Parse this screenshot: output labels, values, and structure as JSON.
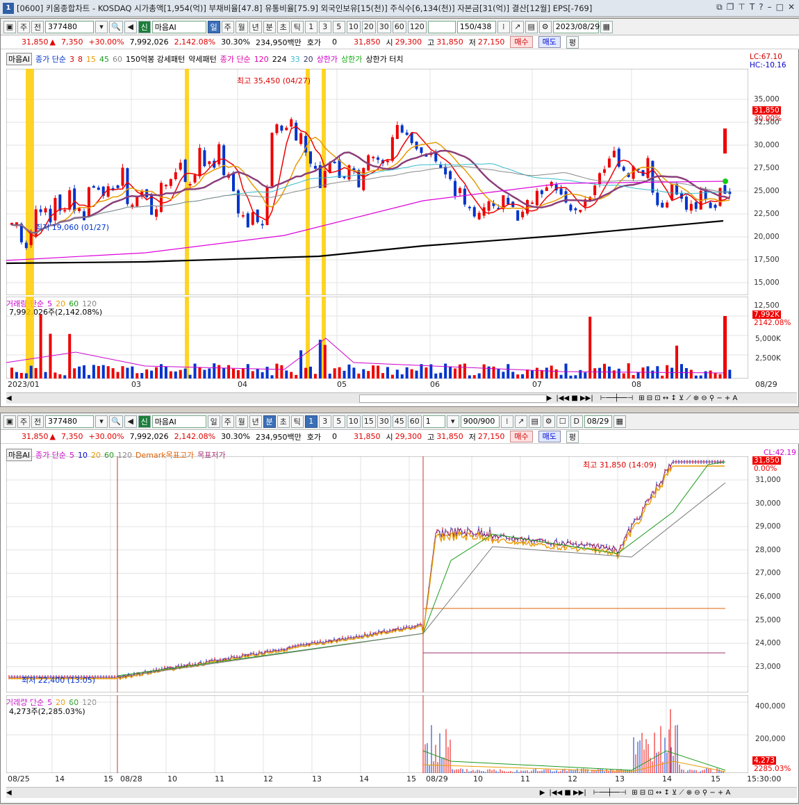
{
  "window": {
    "number": "1",
    "title": "[0600] 키움종합차트 - KOSDAQ 시가총액[1,954(억)] 부채비율[47.8] 유통비율[75.9] 외국인보유[15(천)] 주식수[6,134(천)] 자본금[31(억)] 결산[12월] EPS[-769]"
  },
  "top": {
    "toolbar": {
      "mode1": "주",
      "mode2": "전",
      "code": "377480",
      "search_name": "마음AI",
      "periods": [
        "일",
        "주",
        "월",
        "년",
        "분",
        "초",
        "틱"
      ],
      "nums": [
        "1",
        "3",
        "5",
        "10",
        "20",
        "30",
        "60",
        "120"
      ],
      "count": "150/438",
      "date": "2023/08/29"
    },
    "info": {
      "price": "31,850",
      "change": "7,350",
      "pct": "+30.00%",
      "volume": "7,992,026",
      "vol_pct": "2,142.08%",
      "turnover": "30.30%",
      "amount": "234,950백만",
      "quote_label": "호가",
      "quote_val": "0",
      "quote_price": "31,850",
      "open_label": "시",
      "open": "29,300",
      "high_label": "고",
      "high": "31,850",
      "low_label": "저",
      "low": "27,150",
      "buy": "매수",
      "sell": "매도",
      "avg": "평"
    },
    "legend": {
      "name": "마음AI",
      "ma": "종가 단순",
      "ma_periods": [
        "3",
        "8",
        "15",
        "45",
        "60"
      ],
      "pattern1": "150억봉 강세패턴",
      "pattern2": "약세패턴",
      "ma2": "종가 단순",
      "ma2_periods": [
        "120",
        "224",
        "33",
        "20"
      ],
      "upper": "상한가",
      "upper2": "상한가",
      "touch": "상한가 터치"
    },
    "lc": "LC:67.10",
    "hc": "HC:-10.16",
    "max_label": "최고 35,450 (04/27)",
    "min_label": "최저 19,060 (01/27)",
    "price_ticks": [
      "35,000",
      "32,500",
      "30,000",
      "27,500",
      "25,000",
      "22,500",
      "20,000",
      "17,500",
      "15,000",
      "12,500"
    ],
    "last_tag": "31,850",
    "last_pct": "30.00%",
    "vol_legend": "거래량 단순",
    "vol_periods": [
      "5",
      "20",
      "60",
      "120"
    ],
    "vol_value": "7,992,026주(2,142.08%)",
    "vol_ticks": [
      "5,000K",
      "2,500K"
    ],
    "vol_tag": "7,992K",
    "vol_tag_pct": "2142.08%",
    "x_labels": [
      "2023/01",
      "03",
      "04",
      "05",
      "06",
      "07",
      "08",
      "08/29"
    ]
  },
  "bottom": {
    "toolbar": {
      "mode1": "주",
      "mode2": "전",
      "code": "377480",
      "search_name": "마음AI",
      "periods": [
        "일",
        "주",
        "월",
        "년",
        "분",
        "초",
        "틱"
      ],
      "nums": [
        "1",
        "3",
        "5",
        "10",
        "15",
        "30",
        "45",
        "60"
      ],
      "sel_num": "1",
      "count": "900/900",
      "date": "08/29"
    },
    "info": {
      "price": "31,850",
      "change": "7,350",
      "pct": "+30.00%",
      "volume": "7,992,026",
      "vol_pct": "2,142.08%",
      "turnover": "30.30%",
      "amount": "234,950백만",
      "quote_label": "호가",
      "quote_val": "0",
      "quote_price": "31,850",
      "open_label": "시",
      "open": "29,300",
      "high_label": "고",
      "high": "31,850",
      "low_label": "저",
      "low": "27,150",
      "buy": "매수",
      "sell": "매도",
      "avg": "평"
    },
    "legend": {
      "name": "마음AI",
      "ma": "종가 단순",
      "ma_periods": [
        "5",
        "10",
        "20",
        "60",
        "120"
      ],
      "demark_high": "Demark목표고가",
      "demark_low": "목표저가"
    },
    "cl": "CL:42.19",
    "pct0": "0.00%",
    "max_label": "최고 31,850 (14:09)",
    "min_label": "최저 22,400 (13:05)",
    "price_ticks": [
      "31,000",
      "30,000",
      "29,000",
      "28,000",
      "27,000",
      "26,000",
      "25,000",
      "24,000",
      "23,000"
    ],
    "last_tag": "31,850",
    "vol_legend": "거래량 단순",
    "vol_periods": [
      "5",
      "20",
      "60",
      "120"
    ],
    "vol_value": "4,273주(2,285.03%)",
    "vol_ticks": [
      "400,000",
      "200,000"
    ],
    "vol_tag": "4,273",
    "vol_tag_pct": "2285.03%",
    "x_labels": [
      "08/25",
      "14",
      "15",
      "08/28",
      "10",
      "11",
      "12",
      "13",
      "14",
      "15",
      "08/29",
      "10",
      "11",
      "12",
      "13",
      "14",
      "15",
      "15:30:00"
    ]
  }
}
